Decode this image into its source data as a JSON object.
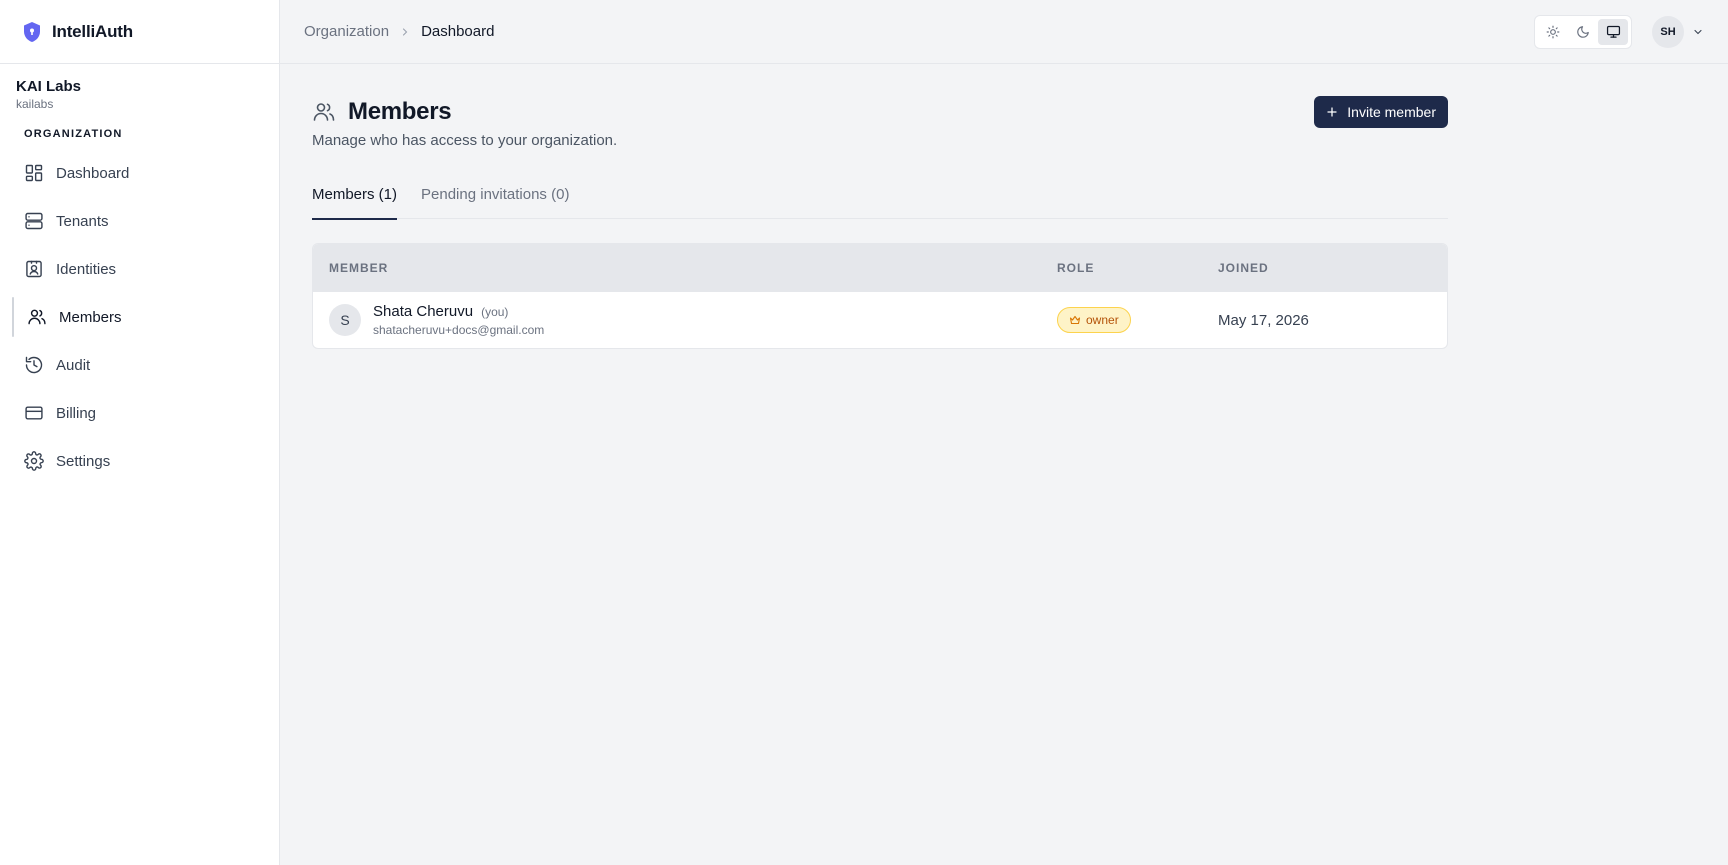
{
  "app": {
    "name": "IntelliAuth"
  },
  "org": {
    "name": "KAI Labs",
    "slug": "kailabs"
  },
  "sidebar": {
    "section_label": "ORGANIZATION",
    "items": [
      {
        "label": "Dashboard",
        "icon": "dashboard-icon"
      },
      {
        "label": "Tenants",
        "icon": "server-icon"
      },
      {
        "label": "Identities",
        "icon": "id-badge-icon"
      },
      {
        "label": "Members",
        "icon": "users-icon",
        "active": true
      },
      {
        "label": "Audit",
        "icon": "history-icon"
      },
      {
        "label": "Billing",
        "icon": "credit-card-icon"
      },
      {
        "label": "Settings",
        "icon": "gear-icon"
      }
    ]
  },
  "breadcrumb": {
    "parent": "Organization",
    "current": "Dashboard"
  },
  "header": {
    "user_initials": "SH",
    "theme_active": "system"
  },
  "page": {
    "title": "Members",
    "description": "Manage who has access to your organization.",
    "invite_label": "Invite member"
  },
  "tabs": [
    {
      "label": "Members (1)",
      "active": true
    },
    {
      "label": "Pending invitations (0)",
      "active": false
    }
  ],
  "table": {
    "columns": [
      "MEMBER",
      "ROLE",
      "JOINED"
    ],
    "rows": [
      {
        "initial": "S",
        "name": "Shata Cheruvu",
        "you_tag": "(you)",
        "email": "shatacheruvu+docs@gmail.com",
        "role": "owner",
        "joined": "May 17, 2026"
      }
    ]
  },
  "colors": {
    "primary": "#1e2a4a",
    "owner_badge_bg": "#fef3c7",
    "owner_badge_text": "#b45309",
    "logo": "#6366f1"
  }
}
